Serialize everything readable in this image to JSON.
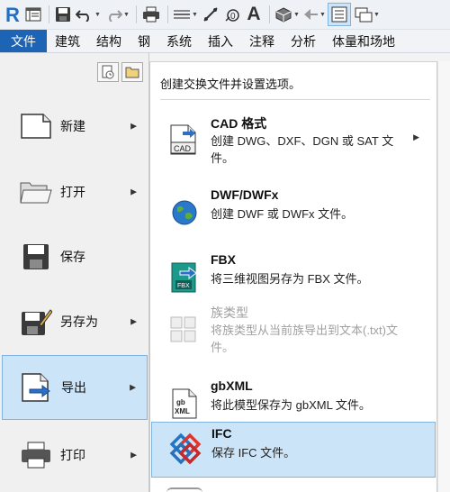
{
  "menubar": {
    "tabs": [
      "文件",
      "建筑",
      "结构",
      "钢",
      "系统",
      "插入",
      "注释",
      "分析",
      "体量和场地"
    ]
  },
  "qat": {
    "text_icon": "A"
  },
  "left_menu": [
    {
      "label": "新建",
      "has_arrow": true,
      "icon": "new-document-icon"
    },
    {
      "label": "打开",
      "has_arrow": true,
      "icon": "open-folder-icon"
    },
    {
      "label": "保存",
      "has_arrow": false,
      "icon": "save-icon"
    },
    {
      "label": "另存为",
      "has_arrow": true,
      "icon": "save-as-icon"
    },
    {
      "label": "导出",
      "has_arrow": true,
      "icon": "export-icon",
      "selected": true
    },
    {
      "label": "打印",
      "has_arrow": true,
      "icon": "print-icon"
    }
  ],
  "export_panel": {
    "header": "创建交换文件并设置选项。",
    "items": [
      {
        "title": "CAD 格式",
        "desc": "创建 DWG、DXF、DGN 或 SAT 文件。",
        "icon": "cad-file-icon",
        "has_arrow": true
      },
      {
        "title": "DWF/DWFx",
        "desc": "创建 DWF 或 DWFx 文件。",
        "icon": "globe-icon"
      },
      {
        "title": "FBX",
        "desc": "将三维视图另存为 FBX 文件。",
        "icon": "fbx-file-icon"
      },
      {
        "title": "族类型",
        "desc": "将族类型从当前族导出到文本(.txt)文件。",
        "icon": "family-types-icon",
        "disabled": true
      },
      {
        "title": "gbXML",
        "desc": "将此模型保存为 gbXML 文件。",
        "icon": "gbxml-file-icon"
      },
      {
        "title": "IFC",
        "desc": "保存 IFC 文件。",
        "icon": "ifc-icon",
        "selected": true
      }
    ]
  },
  "colors": {
    "file_tab": "#1e64b4",
    "selection": "#cce4f8",
    "selection_border": "#7fb4e0"
  }
}
